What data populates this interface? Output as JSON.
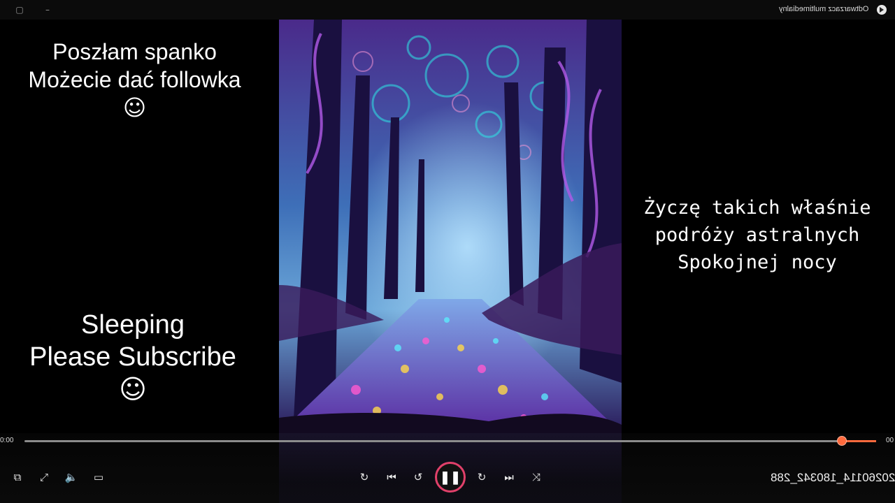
{
  "window": {
    "title": "Odtwarzacz multimedialny",
    "icons": [
      "play-circle-icon",
      "restore-icon",
      "minimize-icon"
    ]
  },
  "overlay": {
    "left_top": [
      "Poszłam spanko",
      "Możecie dać followka",
      "☺"
    ],
    "left_bottom": [
      "Sleeping",
      "Please Subscribe",
      "☺"
    ],
    "right": [
      "Życzę takich właśnie",
      "podróży astralnych",
      "Spokojnej nocy"
    ]
  },
  "player": {
    "time_elapsed": "0:00",
    "time_total": "00",
    "progress": 0.96,
    "file_name": "_20260114_180342_288",
    "accent": "#ff6a3d",
    "controls": [
      "mini-player-icon",
      "fullscreen-icon",
      "volume-icon",
      "subtitles-icon",
      "repeat-icon",
      "previous-icon",
      "rewind-30-icon",
      "pause-icon",
      "forward-10-icon",
      "next-icon",
      "shuffle-icon"
    ]
  }
}
